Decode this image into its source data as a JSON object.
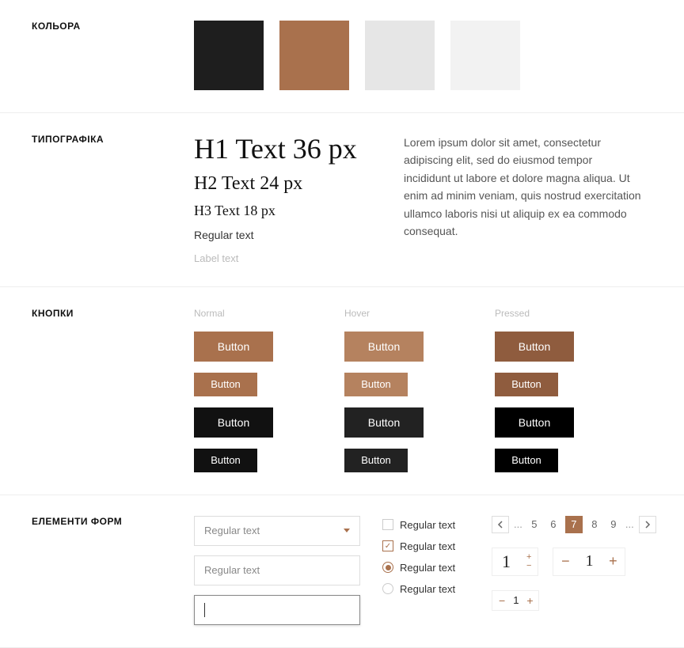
{
  "sections": {
    "colors": {
      "title": "КОЛЬОРА"
    },
    "typography": {
      "title": "ТИПОГРАФІКА"
    },
    "buttons": {
      "title": "КНОПКИ"
    },
    "forms": {
      "title": "ЕЛЕМЕНТИ ФОРМ"
    }
  },
  "swatches": [
    "#1e1e1e",
    "#a9714d",
    "#e6e6e6",
    "#f2f2f2"
  ],
  "typography": {
    "h1": "H1 Text 36 px",
    "h2": "H2 Text 24 px",
    "h3": "H3 Text 18 px",
    "regular": "Regular text",
    "label": "Label text",
    "paragraph": "Lorem ipsum dolor sit amet, consectetur adipiscing elit, sed do eiusmod tempor incididunt ut labore et dolore magna aliqua. Ut enim ad minim veniam, quis nostrud exercitation ullamco laboris nisi ut aliquip ex ea commodo consequat."
  },
  "buttons": {
    "states": [
      "Normal",
      "Hover",
      "Pressed"
    ],
    "label": "Button"
  },
  "forms": {
    "select_placeholder": "Regular text",
    "input_placeholder": "Regular text",
    "check_label": "Regular text",
    "pagination": {
      "left": [
        "5",
        "6"
      ],
      "active": "7",
      "right": [
        "8",
        "9"
      ],
      "ellipsis": "..."
    },
    "stepper_a": "1",
    "stepper_b": "1",
    "stepper_c": "1"
  }
}
